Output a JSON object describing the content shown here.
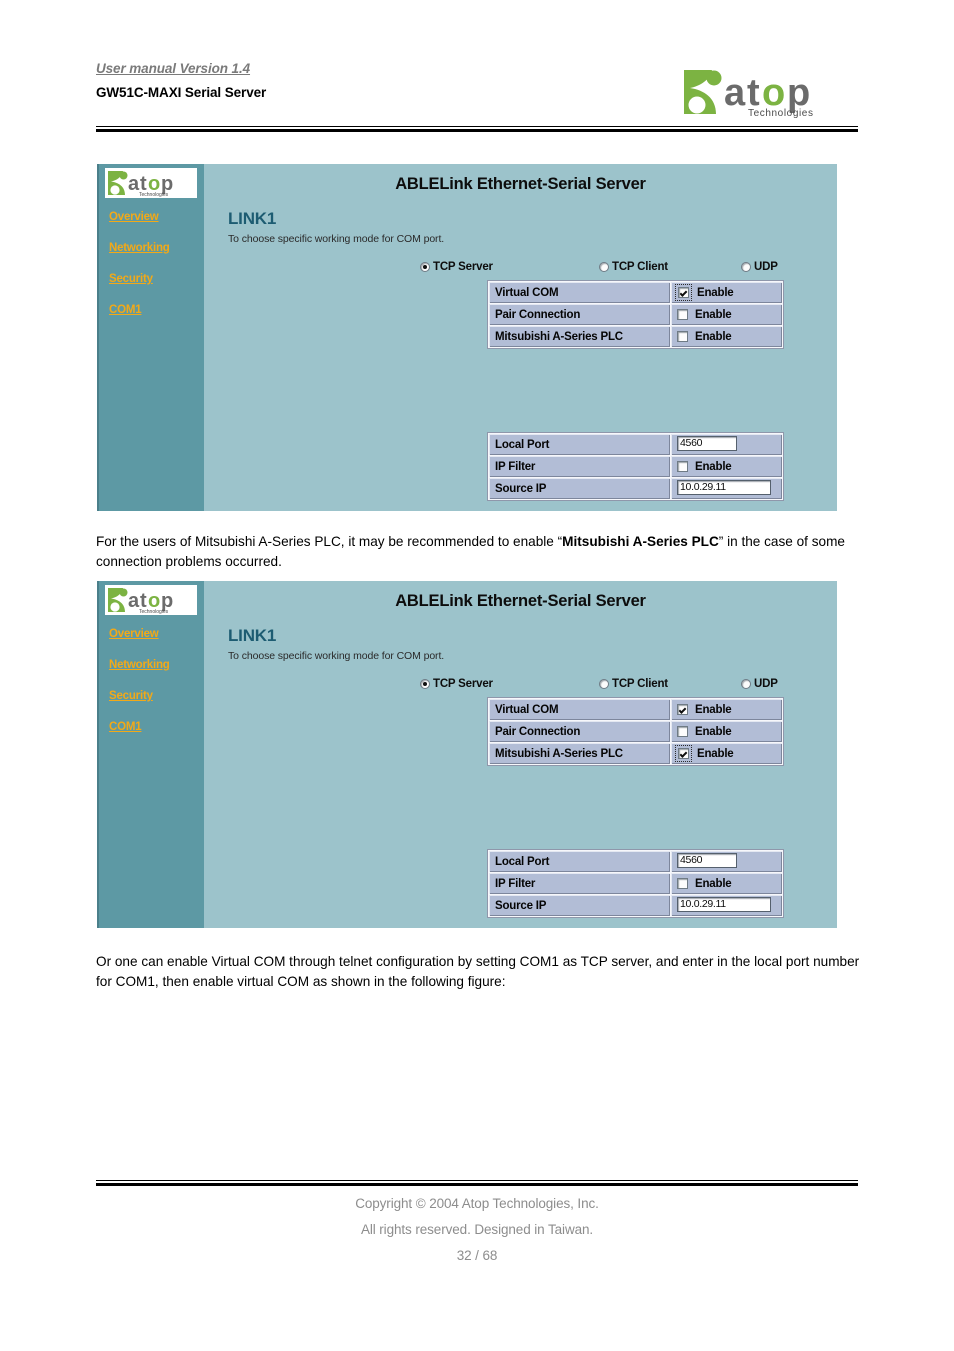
{
  "header": {
    "version_line": "User manual Version 1.4",
    "model_line": "GW51C-MAXI Serial Server",
    "logo_name": "atop-logo",
    "logo_wordmark": "atop",
    "logo_tagline": "Technologies"
  },
  "figures": [
    {
      "sidebar": {
        "logo_wordmark": "atop",
        "logo_tagline": "Technologies",
        "items": [
          {
            "label": "Overview"
          },
          {
            "label": "Networking"
          },
          {
            "label": "Security"
          },
          {
            "label": "COM1"
          }
        ]
      },
      "title": "ABLELink Ethernet-Serial Server",
      "link_heading": "LINK1",
      "link_subtitle": "To choose specific working mode for COM port.",
      "modes": [
        {
          "label": "TCP Server",
          "selected": true
        },
        {
          "label": "TCP Client",
          "selected": false
        },
        {
          "label": "UDP",
          "selected": false
        }
      ],
      "mode_table": {
        "rows": [
          {
            "label": "Virtual COM",
            "enable_label": "Enable",
            "checked": true,
            "focused": true
          },
          {
            "label": "Pair Connection",
            "enable_label": "Enable",
            "checked": false,
            "focused": false
          },
          {
            "label": "Mitsubishi A-Series PLC",
            "enable_label": "Enable",
            "checked": false,
            "focused": false
          }
        ]
      },
      "port_table": {
        "local_port_label": "Local Port",
        "local_port_value": "4560",
        "ip_filter_label": "IP Filter",
        "ip_filter_enable_label": "Enable",
        "ip_filter_checked": false,
        "source_ip_label": "Source IP",
        "source_ip_value": "10.0.29.11"
      }
    },
    {
      "sidebar": {
        "logo_wordmark": "atop",
        "logo_tagline": "Technologies",
        "items": [
          {
            "label": "Overview"
          },
          {
            "label": "Networking"
          },
          {
            "label": "Security"
          },
          {
            "label": "COM1"
          }
        ]
      },
      "title": "ABLELink Ethernet-Serial Server",
      "link_heading": "LINK1",
      "link_subtitle": "To choose specific working mode for COM port.",
      "modes": [
        {
          "label": "TCP Server",
          "selected": true
        },
        {
          "label": "TCP Client",
          "selected": false
        },
        {
          "label": "UDP",
          "selected": false
        }
      ],
      "mode_table": {
        "rows": [
          {
            "label": "Virtual COM",
            "enable_label": "Enable",
            "checked": true,
            "focused": false
          },
          {
            "label": "Pair Connection",
            "enable_label": "Enable",
            "checked": false,
            "focused": false
          },
          {
            "label": "Mitsubishi A-Series PLC",
            "enable_label": "Enable",
            "checked": true,
            "focused": true
          }
        ]
      },
      "port_table": {
        "local_port_label": "Local Port",
        "local_port_value": "4560",
        "ip_filter_label": "IP Filter",
        "ip_filter_enable_label": "Enable",
        "ip_filter_checked": false,
        "source_ip_label": "Source IP",
        "source_ip_value": "10.0.29.11"
      }
    }
  ],
  "paragraphs": {
    "p1_part1": "For the users of Mitsubishi A-Series PLC, it may be recommended to enable “",
    "p1_bold": "Mitsubishi A-Series PLC",
    "p1_part2": "” in the case of some connection problems occurred.",
    "p2": "Or one can enable Virtual COM through telnet configuration by setting COM1 as TCP server, and enter in the local port number for COM1, then enable virtual COM as shown in the following figure:"
  },
  "footer": {
    "copyright": "Copyright © 2004 Atop Technologies, Inc.",
    "rights": "All rights reserved. Designed in Taiwan.",
    "page": "32 / 68"
  },
  "colors": {
    "sidebar_bg": "#5d99a4",
    "content_bg": "#9cc3cb",
    "nav_link": "#f2a918",
    "heading_blue": "#1d5c72",
    "table_cell": "#b2bdd6",
    "brand_green": "#7cb342",
    "brand_gray": "#6b6b6b"
  }
}
